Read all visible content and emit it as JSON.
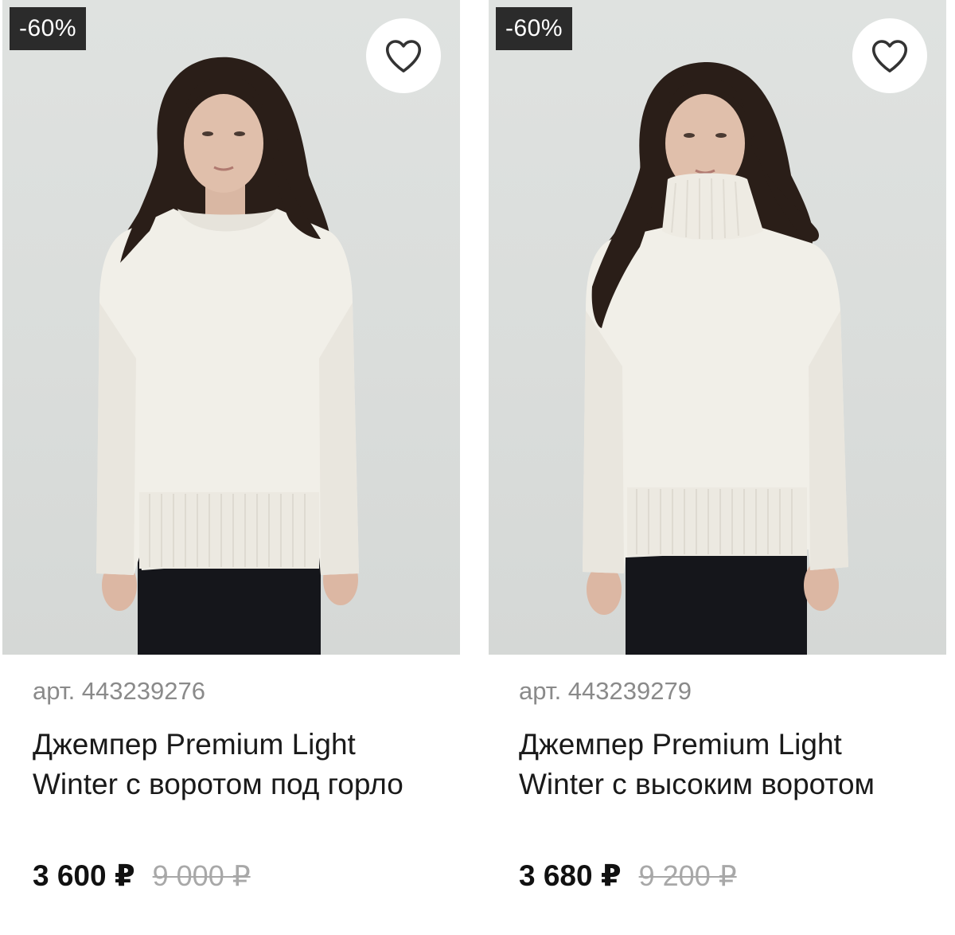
{
  "products": [
    {
      "discount_badge": "-60%",
      "sku": "арт. 443239276",
      "title": "Джемпер Premium Light Winter с воротом под горло",
      "price": "3 600 ₽",
      "old_price": "9 000 ₽",
      "favorite_icon": "heart-outline-icon"
    },
    {
      "discount_badge": "-60%",
      "sku": "арт. 443239279",
      "title": "Джемпер Premium Light Winter с высоким воротом",
      "price": "3 680 ₽",
      "old_price": "9 200 ₽",
      "favorite_icon": "heart-outline-icon"
    }
  ],
  "colors": {
    "badge_bg": "#2b2b2b",
    "price": "#111111",
    "old_price": "#a8a8a8",
    "sku": "#8a8a8a"
  }
}
